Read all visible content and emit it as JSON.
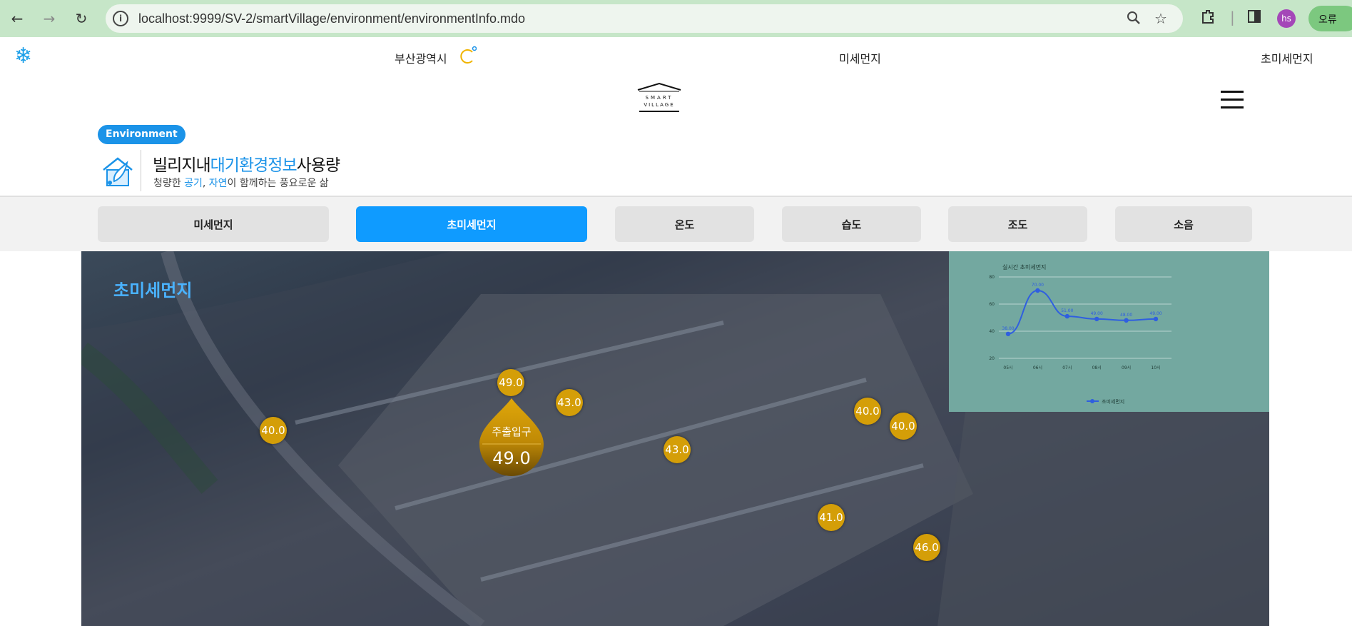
{
  "browser": {
    "url": "localhost:9999/SV-2/smartVillage/environment/environmentInfo.mdo",
    "profile_initials": "hs",
    "error_label": "오류"
  },
  "topbar": {
    "city": "부산광역시",
    "pm10_label": "미세먼지",
    "pm25_label": "초미세먼지"
  },
  "logo": {
    "line1": "SMART",
    "line2": "VILLAGE"
  },
  "section": {
    "badge": "Environment",
    "title_pre": "빌리지내",
    "title_hl": "대기환경정보",
    "title_post": "사용량",
    "sub_pre": "청량한 ",
    "sub_hl1": "공기",
    "sub_mid": ", ",
    "sub_hl2": "자연",
    "sub_post": "이 함께하는 풍요로운 삶"
  },
  "tabs": [
    {
      "label": "미세먼지",
      "active": false
    },
    {
      "label": "초미세먼지",
      "active": true
    },
    {
      "label": "온도",
      "active": false
    },
    {
      "label": "습도",
      "active": false
    },
    {
      "label": "조도",
      "active": false
    },
    {
      "label": "소음",
      "active": false
    }
  ],
  "map": {
    "label": "초미세먼지",
    "markers": [
      "49.0",
      "43.0",
      "40.0",
      "43.0",
      "40.0",
      "40.0",
      "41.0",
      "46.0"
    ],
    "highlight": {
      "label": "주출입구",
      "value": "49.0"
    }
  },
  "chart_data": {
    "type": "line",
    "title": "실시간 초미세먼지",
    "categories": [
      "05시",
      "06시",
      "07시",
      "08시",
      "09시",
      "10시"
    ],
    "series": [
      {
        "name": "초미세먼지",
        "values": [
          38.0,
          70.0,
          51.0,
          49.0,
          48.0,
          49.0
        ],
        "labels": [
          "38.00",
          "70.00",
          "51.00",
          "49.00",
          "48.00",
          "49.00"
        ]
      }
    ],
    "yticks": [
      20,
      40,
      60,
      80
    ],
    "ylim": [
      20,
      80
    ],
    "grid": true,
    "legend": "bottom",
    "colors": {
      "line": "#2f5fe0",
      "panel": "#73a8a0"
    }
  }
}
